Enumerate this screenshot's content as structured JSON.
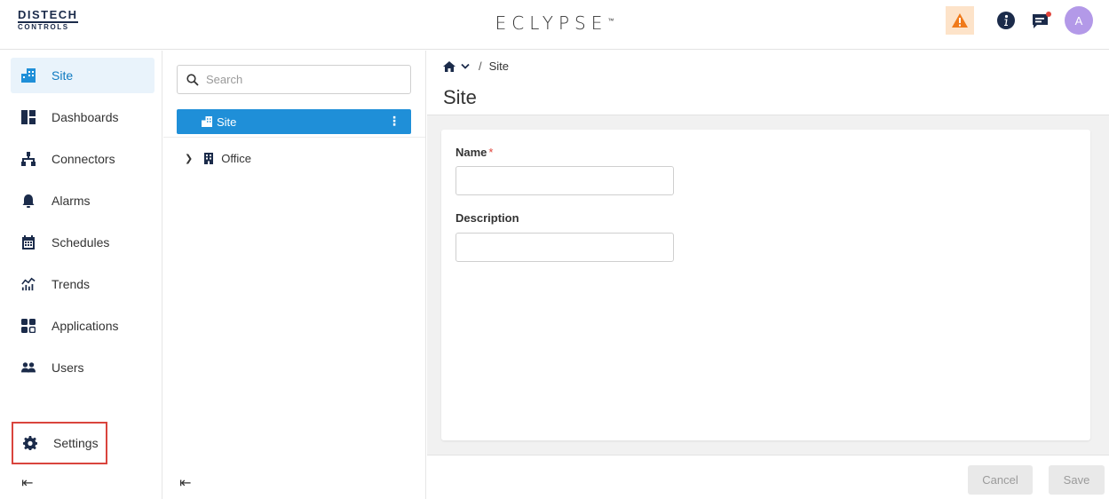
{
  "header": {
    "brand_line1": "DISTECH",
    "brand_line2": "CONTROLS",
    "product": "ECLYPSE",
    "product_mark": "™",
    "avatar_initial": "A",
    "alert_icon": "warning-triangle-icon",
    "info_icon": "info-circle-icon",
    "message_icon": "chat-notification-icon",
    "alert_bg": "#fde3c9",
    "alert_color": "#f07a1a",
    "avatar_color": "#b399e8"
  },
  "nav": {
    "items": [
      {
        "label": "Site",
        "icon": "building-icon",
        "active": true
      },
      {
        "label": "Dashboards",
        "icon": "dashboard-icon"
      },
      {
        "label": "Connectors",
        "icon": "network-icon"
      },
      {
        "label": "Alarms",
        "icon": "bell-icon"
      },
      {
        "label": "Schedules",
        "icon": "calendar-icon"
      },
      {
        "label": "Trends",
        "icon": "trend-chart-icon"
      },
      {
        "label": "Applications",
        "icon": "apps-grid-icon"
      },
      {
        "label": "Users",
        "icon": "users-icon"
      }
    ],
    "settings_label": "Settings",
    "accent_color": "#0f7ac0"
  },
  "tree": {
    "search_placeholder": "Search",
    "site_label": "Site",
    "office_label": "Office",
    "selected_color": "#1f8fd8"
  },
  "main": {
    "breadcrumb_sep": "/",
    "breadcrumb_current": "Site",
    "title": "Site",
    "name_label": "Name",
    "name_required": "*",
    "name_value": "",
    "description_label": "Description",
    "description_value": "",
    "cancel_label": "Cancel",
    "save_label": "Save",
    "highlight_color": "#d9443d"
  }
}
